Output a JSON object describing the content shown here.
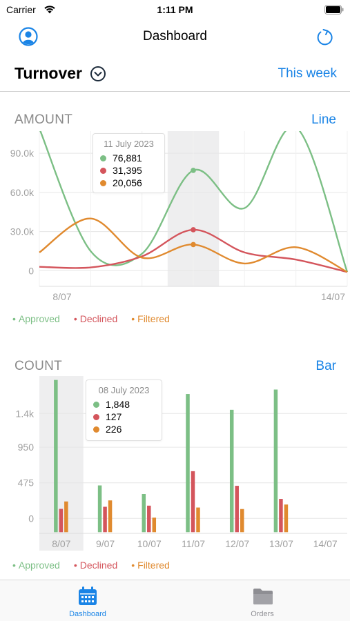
{
  "status_bar": {
    "carrier": "Carrier",
    "time": "1:11 PM"
  },
  "nav": {
    "title": "Dashboard"
  },
  "header": {
    "title": "Turnover",
    "period": "This week"
  },
  "colors": {
    "approved": "#7cbf85",
    "declined": "#d4555c",
    "filtered": "#e08a2f",
    "accent": "#1a84e6"
  },
  "amount_section": {
    "title": "AMOUNT",
    "chart_type": "Line",
    "tooltip": {
      "date": "11 July 2023",
      "approved": "76,881",
      "declined": "31,395",
      "filtered": "20,056"
    }
  },
  "count_section": {
    "title": "COUNT",
    "chart_type": "Bar",
    "tooltip": {
      "date": "08 July 2023",
      "approved": "1,848",
      "declined": "127",
      "filtered": "226"
    }
  },
  "legend": {
    "approved": "Approved",
    "declined": "Declined",
    "filtered": "Filtered"
  },
  "tabs": [
    {
      "label": "Dashboard",
      "icon": "calendar-icon",
      "active": true
    },
    {
      "label": "Orders",
      "icon": "folder-icon",
      "active": false
    }
  ],
  "chart_data": [
    {
      "type": "line",
      "title": "AMOUNT",
      "x": [
        "8/07",
        "9/07",
        "10/07",
        "11/07",
        "12/07",
        "13/07",
        "14/07"
      ],
      "x_tick_labels": [
        "8/07",
        "14/07"
      ],
      "y_tick_labels": [
        "0",
        "30.0k",
        "60.0k",
        "90.0k"
      ],
      "ylim": [
        -12000,
        107000
      ],
      "grid": true,
      "legend": "bottom",
      "highlight": {
        "x": "11/07"
      },
      "series": [
        {
          "name": "Approved",
          "color": "#7cbf85",
          "values": [
            109000,
            15000,
            13000,
            76881,
            48000,
            110000,
            -1000
          ]
        },
        {
          "name": "Declined",
          "color": "#d4555c",
          "values": [
            3000,
            2500,
            11000,
            31395,
            14000,
            8500,
            -1000
          ]
        },
        {
          "name": "Filtered",
          "color": "#e08a2f",
          "values": [
            14000,
            40000,
            10000,
            20056,
            5500,
            18000,
            -1000
          ]
        }
      ]
    },
    {
      "type": "bar",
      "title": "COUNT",
      "categories": [
        "8/07",
        "9/07",
        "10/07",
        "11/07",
        "12/07",
        "13/07",
        "14/07"
      ],
      "y_tick_labels": [
        "0",
        "475",
        "950",
        "1.4k"
      ],
      "ylim": [
        -200,
        1900
      ],
      "grid": true,
      "legend": "bottom",
      "highlight": {
        "category": "8/07"
      },
      "series": [
        {
          "name": "Approved",
          "color": "#7cbf85",
          "values": [
            1848,
            440,
            325,
            1660,
            1450,
            1720,
            0
          ]
        },
        {
          "name": "Declined",
          "color": "#d4555c",
          "values": [
            127,
            155,
            170,
            630,
            435,
            260,
            0
          ]
        },
        {
          "name": "Filtered",
          "color": "#e08a2f",
          "values": [
            226,
            240,
            10,
            145,
            125,
            185,
            0
          ]
        }
      ]
    }
  ]
}
